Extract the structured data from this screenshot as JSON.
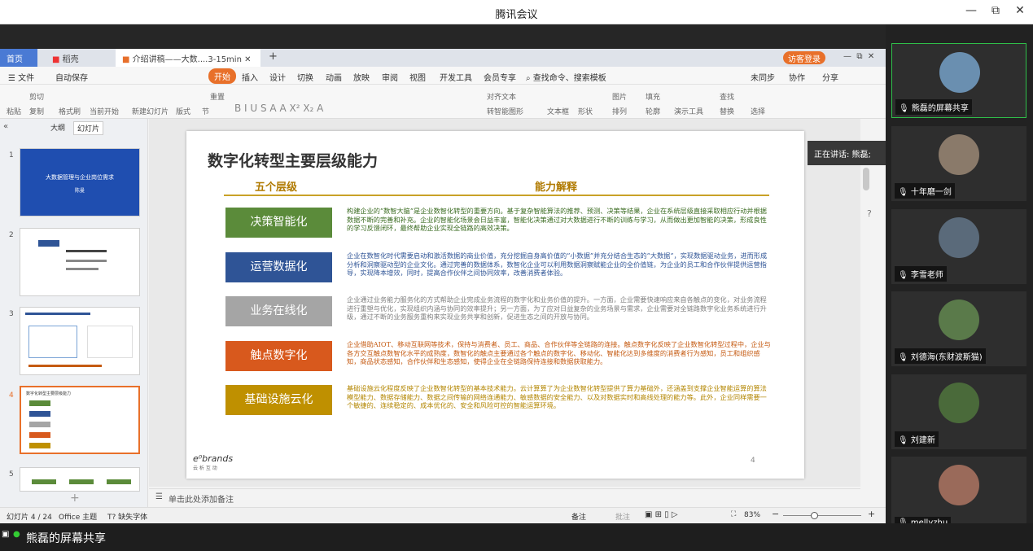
{
  "app": {
    "title": "腾讯会议"
  },
  "window": {
    "min": "—",
    "max": "⧉",
    "close": "✕"
  },
  "tabs": [
    {
      "label": "首页"
    },
    {
      "label": "稻壳"
    },
    {
      "label": "介绍讲稿——大数....3-15min"
    }
  ],
  "toolbar": {
    "login": "访客登录",
    "unsynced": "未同步",
    "collab": "协作",
    "share": "分享"
  },
  "menu": {
    "file": "文件",
    "autosave": "自动保存",
    "start": "开始",
    "insert": "插入",
    "design": "设计",
    "switch": "切换",
    "animation": "动画",
    "slideshow": "放映",
    "review": "审阅",
    "view": "视图",
    "dev": "开发工具",
    "member": "会员专享",
    "search": "查找命令、搜索模板"
  },
  "ribbon": {
    "paste": "粘贴",
    "cut": "剪切",
    "copy": "复制",
    "format_painter": "格式刷",
    "current_start": "当前开始",
    "new_slide": "新建幻灯片",
    "layout": "版式",
    "section": "节",
    "reset": "重置",
    "align_text": "对齐文本",
    "smartart": "转智能图形",
    "textbox": "文本框",
    "shape": "形状",
    "arrange": "排列",
    "picture": "图片",
    "fill": "填充",
    "outline": "轮廓",
    "present_tool": "演示工具",
    "find": "查找",
    "replace": "替换",
    "select": "选择"
  },
  "leftpane": {
    "outline_tab": "大纲",
    "slides_tab": "幻灯片",
    "slide1_title": "大数据管理与企业岗位需求",
    "slide1_sub": "陈曼",
    "slide4_title": "数字化转型主要层级能力"
  },
  "slide": {
    "title": "数字化转型主要层级能力",
    "col1": "五个层级",
    "col2": "能力解释",
    "levels": [
      {
        "label": "决策智能化",
        "color": "#5b8b3a",
        "text_color": "#3a6b20",
        "desc": "构建企业的”数智大脑”是企业数智化转型的重要方向。基于复杂智能算法的推荐、预测、决策等结果，企业在系统层级直接采取相应行动并根据数据不断的完善和补充。企业的智能化场景会日益丰富，智能化决策通过对大数据进行不断的训练与学习，从而做出更加智能的决策，形成良性的学习反馈闭环，最终帮助企业实现全链路的高效决策。"
      },
      {
        "label": "运营数据化",
        "color": "#2f5496",
        "text_color": "#2f5496",
        "desc": "企业在数智化时代需要启动和激活数据的商业价值，充分挖掘自身高价值的”小数据”并充分结合生态的”大数据”，实现数据驱动业务，进而形成分析和洞察驱动型的企业文化。通过完善的数据体系，数智化企业可以利用数据洞察赋能企业的全价值链，为企业的员工和合作伙伴提供运营指导，实现降本增效，同时，提高合作伙伴之间协同效率，改善消费者体验。"
      },
      {
        "label": "业务在线化",
        "color": "#a5a5a5",
        "text_color": "#7f7f7f",
        "desc": "企业通过业务能力服务化的方式帮助企业完成业务流程的数字化和业务价值的提升。一方面，企业需要快速响应来自各触点的变化，对业务流程进行重塑与优化，实现组织内涵与协同的效率提升；另一方面，为了应对日益复杂的业务场景与需求，企业需要对全链路数字化业务系统进行升级，通过不断的业务服务重构来实现业务共享和创新，促进生态之间的开放与协同。"
      },
      {
        "label": "触点数字化",
        "color": "#d8591d",
        "text_color": "#c55a11",
        "desc": "企业借助AIOT、移动互联网等技术，保持与消费者、员工、商品、合作伙伴等全链路的连接。触点数字化反映了企业数智化转型过程中，企业与各方交互触点数智化水平的成熟度，数智化的触点主要通过各个触点的数字化、移动化、智能化达到多维度的消费者行为感知，员工和组织感知，商品状态感知，合作伙伴和生态感知，使得企业在全链路保持连接和数据获取能力。"
      },
      {
        "label": "基础设施云化",
        "color": "#bf9000",
        "text_color": "#b38600",
        "desc": "基础设施云化程度反映了企业数智化转型的基本技术能力。云计算算了为企业数智化转型提供了算力基础外，还涵盖到支撑企业智能运算的算法模型能力、数据存储能力、数据之间传输的网络连通能力、敏感数据的安全能力、以及对数据实时和高线处理的能力等。此外，企业同样需要一个敏捷的、连续稳定的、成本优化的、安全和风险可控的智能运算环境。"
      }
    ],
    "logo": "e⁰brands",
    "logo_sub": "云 析 互 动",
    "page": "4"
  },
  "notes": {
    "placeholder": "单击此处添加备注"
  },
  "status": {
    "slide_count": "幻灯片 4 / 24",
    "theme": "Office 主题",
    "font": "缺失字体",
    "notes_btn": "备注",
    "comment_btn": "批注",
    "zoom": "83%"
  },
  "speaking": "正在讲话: 熊磊;",
  "participants": [
    {
      "name": "熊磊的屏幕共享",
      "bg": "#6a8fb0"
    },
    {
      "name": "十年磨一剑",
      "bg": "#8a7a6a"
    },
    {
      "name": "李雪老师",
      "bg": "#5a6a7a"
    },
    {
      "name": "刘德海(东财波斯猫)",
      "bg": "#5a7a4a"
    },
    {
      "name": "刘建新",
      "bg": "#4a6a3a"
    },
    {
      "name": "mellyzhu",
      "bg": "#9a6a5a"
    }
  ],
  "bottom": {
    "label": "熊磊的屏幕共享"
  }
}
